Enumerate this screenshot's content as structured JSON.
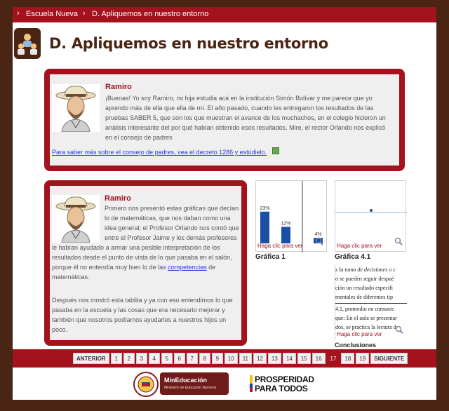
{
  "breadcrumb": {
    "items": [
      "Escuela Nueva",
      "D. Apliquemos en nuestro entorno"
    ]
  },
  "page": {
    "title": "D. Apliquemos en nuestro entorno"
  },
  "story1": {
    "name": "Ramiro",
    "text": "¡Buenas! Yo soy Ramiro, mi hija estudia acá en la institución Simón Bolívar y me parece que yo aprendo más de ella que ella de mí. El año pasado, cuando les entregaron los resultados de las pruebas SABER 5, que son los que muestran el avance de los muchachos, en el colegio hicieron un análisis interesante del por qué habían obtenido esos resultados. Mire, el rector Orlando nos explicó en el consejo de padres",
    "link": "Para saber más sobre el consejo de padres, vea el decreto 1286 y estúdielo."
  },
  "story2": {
    "name": "Ramiro",
    "text_before": "Primero nos presentó estas gráficas que decían lo de matemáticas, que nos daban como una idea general; el Profesor Orlando nos contó que entre el Profesor Jaime y los demás profesores le habían ayudado a armar una posible interpretación de los resultados desde el punto de vista de lo que pasaba en el salón, porque él no entendía muy bien lo de las ",
    "link": "competencias",
    "text_after": " de matemáticas.",
    "text2": "Después nos mostró esta tablita y ya con eso entendimos lo que pasaba en la escuela y las cosas que era necesario mejorar y también que nosotros podíamos ayudarles a nuestros hijos un poco."
  },
  "figures": {
    "hint": "Haga clic para ver",
    "chart1_caption": "Gráfica 1",
    "chart2_caption": "Gráfica 4.1",
    "doc_lines": [
      "s la toma de decisiones o c",
      "o se pueden seguir despué",
      "ción un resultado especifi",
      "mentales de diferentes tip",
      "4.1, promedio en comunic",
      "que: En el aula se presentar",
      "dos, se practica la lectura d"
    ],
    "doc_caption": "Conclusiones"
  },
  "chart_data": {
    "type": "bar",
    "categories": [
      "",
      "",
      ""
    ],
    "values": [
      23,
      12,
      4
    ],
    "labels": [
      "23%",
      "12%",
      "4%"
    ],
    "ylim": [
      0,
      30
    ],
    "color": "#1a4fa8"
  },
  "pager": {
    "prev": "ANTERIOR",
    "pages": [
      "1",
      "2",
      "3",
      "4",
      "5",
      "6",
      "7",
      "8",
      "9",
      "10",
      "11",
      "12",
      "13",
      "14",
      "15",
      "16",
      "17",
      "18",
      "19"
    ],
    "current": "17",
    "next": "SIGUIENTE"
  },
  "footer": {
    "min_title": "MinEducación",
    "min_sub": "Ministerio de Educación Nacional",
    "prosperidad_line1": "PROSPERIDAD",
    "prosperidad_line2": "PARA TODOS"
  },
  "colors": {
    "brand": "#a3121d",
    "dark": "#4a2514",
    "panel": "#efefef",
    "link": "#2a3bd6"
  }
}
